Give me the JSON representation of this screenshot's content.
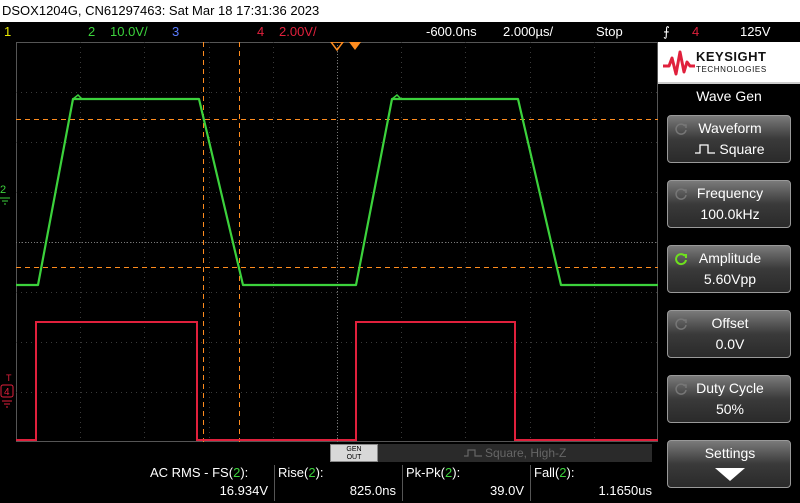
{
  "title": "DSOX1204G, CN61297463: Sat Mar 18 17:31:36 2023",
  "status": {
    "ch1": "1",
    "ch2_num": "2",
    "ch2_scale": "10.0V/",
    "ch3": "3",
    "ch4_num": "4",
    "ch4_scale": "2.00V/",
    "time_delay": "-600.0ns",
    "time_scale": "2.000µs/",
    "run_state": "Stop",
    "trigger_source": "4",
    "trigger_level": "125V"
  },
  "colors": {
    "ch1": "#e8e800",
    "ch2": "#3cd23c",
    "ch3": "#5a7cff",
    "ch4": "#e0203c",
    "cursor": "#ff8c1e"
  },
  "markers": {
    "ch2": "2",
    "ch4": "4",
    "trigger": "T"
  },
  "logo": {
    "brand": "KEYSIGHT",
    "sub": "TECHNOLOGIES"
  },
  "panel": {
    "title": "Wave Gen",
    "softkeys": [
      {
        "label": "Waveform",
        "value": "Square",
        "icon": "rotate-icon",
        "active": false
      },
      {
        "label": "Frequency",
        "value": "100.0kHz",
        "icon": "rotate-icon",
        "active": false
      },
      {
        "label": "Amplitude",
        "value": "5.60Vpp",
        "icon": "rotate-icon",
        "active": true
      },
      {
        "label": "Offset",
        "value": "0.0V",
        "icon": "rotate-icon",
        "active": false
      },
      {
        "label": "Duty Cycle",
        "value": "50%",
        "icon": "rotate-icon",
        "active": false
      },
      {
        "label": "Settings",
        "value": "",
        "icon": "down-arrow-icon",
        "active": false
      }
    ]
  },
  "gen_out": {
    "line1": "GEN",
    "line2": "OUT"
  },
  "wavegen_banner": "Square, High-Z",
  "measurements": [
    {
      "label": "AC RMS - FS",
      "channel": "2",
      "value": "16.934V"
    },
    {
      "label": "Rise",
      "channel": "2",
      "value": "825.0ns"
    },
    {
      "label": "Pk-Pk",
      "channel": "2",
      "value": "39.0V"
    },
    {
      "label": "Fall",
      "channel": "2",
      "value": "1.1650us"
    }
  ]
}
